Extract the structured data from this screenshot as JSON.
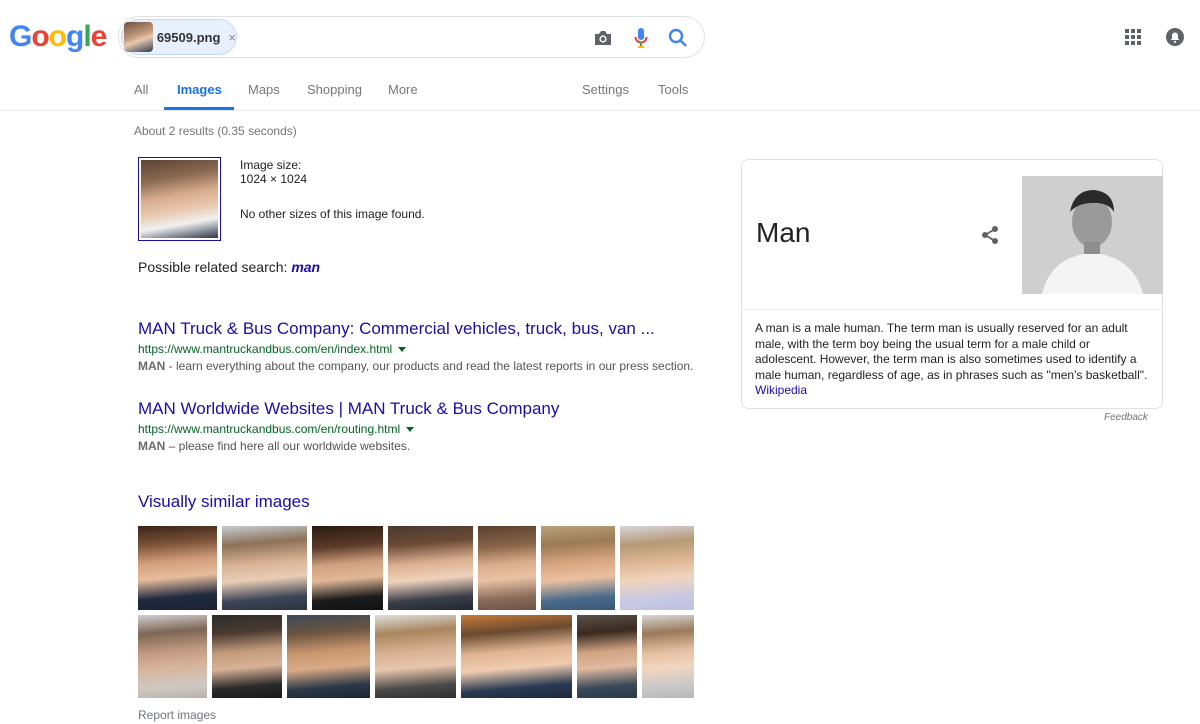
{
  "header": {
    "logo_letters": [
      "G",
      "o",
      "o",
      "g",
      "l",
      "e"
    ],
    "search_chip": {
      "filename": "69509.png",
      "close_glyph": "×"
    },
    "icons": {
      "camera": "camera-icon",
      "mic": "mic-icon",
      "search": "search-icon",
      "apps": "apps-grid-icon",
      "notifications": "notifications-icon"
    }
  },
  "tabs": {
    "items": [
      "All",
      "Images",
      "Maps",
      "Shopping",
      "More",
      "Settings",
      "Tools"
    ],
    "active": "Images"
  },
  "stats": "About 2 results (0.35 seconds)",
  "query_image": {
    "size_label": "Image size:",
    "size_value": "1024 × 1024",
    "no_sizes": "No other sizes of this image found."
  },
  "related": {
    "prefix": "Possible related search:",
    "term": "man"
  },
  "results": [
    {
      "title": "MAN Truck & Bus Company: Commercial vehicles, truck, bus, van ...",
      "url": "https://www.mantruckandbus.com/en/index.html",
      "snippet_bold": "MAN",
      "snippet_rest": " - learn everything about the company, our products and read the latest reports in our press section."
    },
    {
      "title": "MAN Worldwide Websites | MAN Truck & Bus Company",
      "url": "https://www.mantruckandbus.com/en/routing.html",
      "snippet_bold": "MAN",
      "snippet_rest": " – please find here all our worldwide websites."
    }
  ],
  "visually_similar": {
    "title": "Visually similar images",
    "report": "Report images"
  },
  "knowledge_panel": {
    "title": "Man",
    "description": "A man is a male human. The term man is usually reserved for an adult male, with the term boy being the usual term for a male child or adolescent. However, the term man is also sometimes used to identify a male human, regardless of age, as in phrases such as \"men's basketball\".",
    "source": "Wikipedia",
    "feedback": "Feedback"
  },
  "colors": {
    "link": "#1a0dab",
    "url": "#006621",
    "accent": "#1a73e8"
  }
}
